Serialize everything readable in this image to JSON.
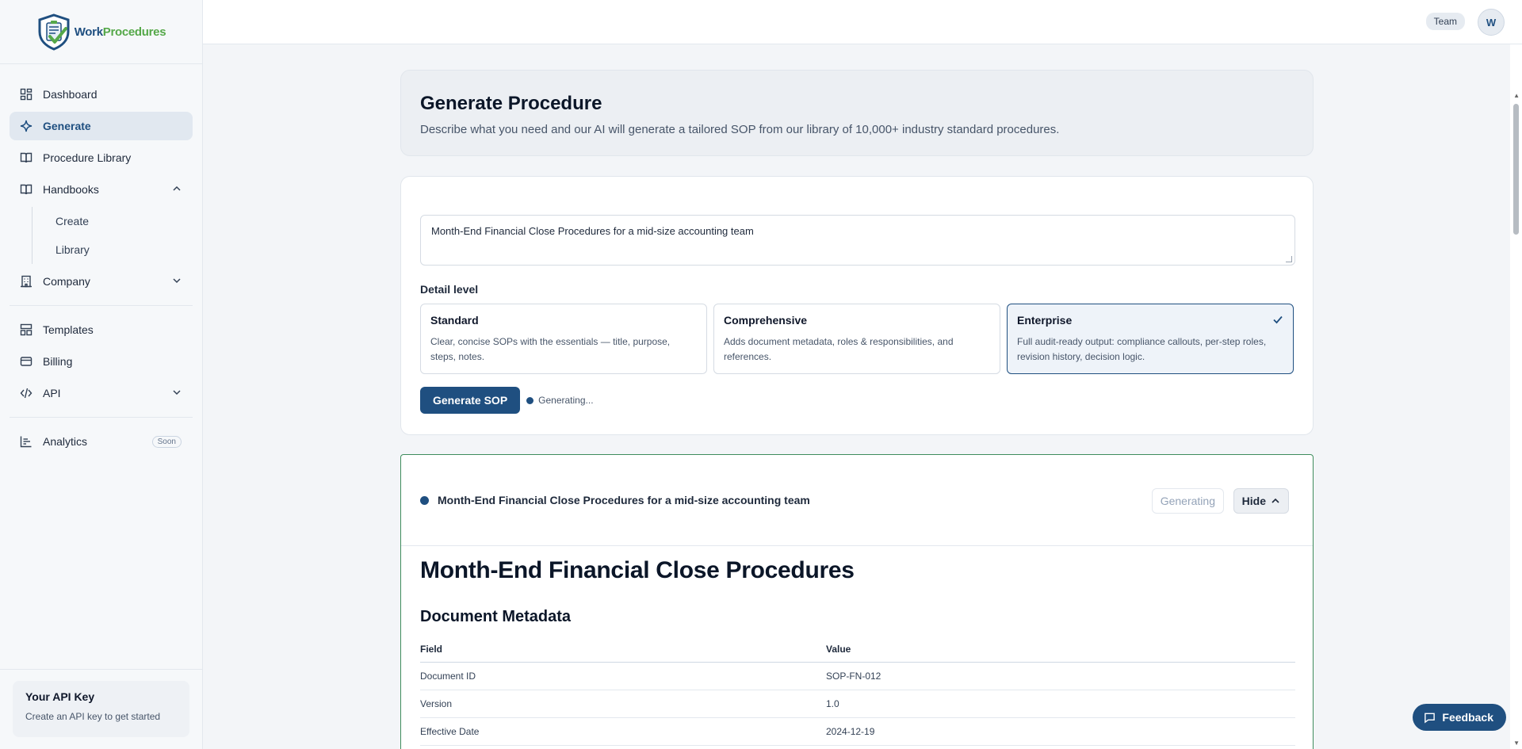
{
  "app": {
    "logo_work": "Work",
    "logo_procedures": "Procedures",
    "brand_blue": "#1f4f80",
    "brand_green": "#55a849"
  },
  "sidebar": {
    "items": [
      {
        "label": "Dashboard",
        "icon": "dashboard-icon"
      },
      {
        "label": "Generate",
        "icon": "sparkle-icon"
      },
      {
        "label": "Procedure Library",
        "icon": "book-icon"
      },
      {
        "label": "Handbooks",
        "icon": "book-open-icon"
      },
      {
        "label": "Company",
        "icon": "building-icon"
      },
      {
        "label": "Templates",
        "icon": "template-icon"
      },
      {
        "label": "Billing",
        "icon": "credit-card-icon"
      },
      {
        "label": "API",
        "icon": "code-icon"
      },
      {
        "label": "Analytics",
        "icon": "chart-icon",
        "badge": "Soon"
      }
    ],
    "handbooks_sub": [
      "Create",
      "Library"
    ],
    "api_box": {
      "title": "Your API Key",
      "subtitle": "Create an API key to get started"
    }
  },
  "topbar": {
    "team_label": "Team",
    "avatar_initial": "W"
  },
  "hero": {
    "title": "Generate Procedure",
    "description": "Describe what you need and our AI will generate a tailored SOP from our library of 10,000+ industry standard procedures."
  },
  "form": {
    "prompt_value": "Month-End Financial Close Procedures for a mid-size accounting team",
    "detail_label": "Detail level",
    "levels": [
      {
        "title": "Standard",
        "desc": "Clear, concise SOPs with the essentials — title, purpose, steps, notes.",
        "selected": false
      },
      {
        "title": "Comprehensive",
        "desc": "Adds document metadata, roles & responsibilities, and references.",
        "selected": false
      },
      {
        "title": "Enterprise",
        "desc": "Full audit-ready output: compliance callouts, per-step roles, revision history, decision logic.",
        "selected": true
      }
    ],
    "generate_button": "Generate SOP",
    "status": "Generating..."
  },
  "result": {
    "title": "Month-End Financial Close Procedures for a mid-size accounting team",
    "status_pill": "Generating",
    "hide_button": "Hide",
    "doc_title": "Month-End Financial Close Procedures",
    "section_title": "Document Metadata",
    "table": {
      "headers": [
        "Field",
        "Value"
      ],
      "rows": [
        [
          "Document ID",
          "SOP-FN-012"
        ],
        [
          "Version",
          "1.0"
        ],
        [
          "Effective Date",
          "2024-12-19"
        ]
      ]
    }
  },
  "feedback_button": "Feedback"
}
